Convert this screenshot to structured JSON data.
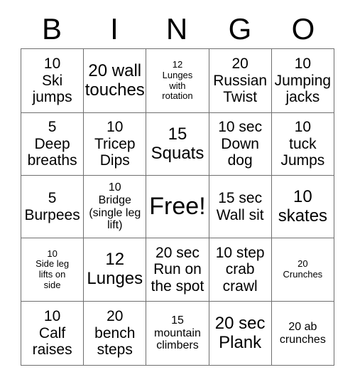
{
  "card": {
    "header": {
      "letters": [
        "B",
        "I",
        "N",
        "G",
        "O"
      ]
    },
    "rows": [
      [
        {
          "text": "10\nSki\njumps",
          "size": "fs-m"
        },
        {
          "text": "20 wall\ntouches",
          "size": "fs-l"
        },
        {
          "text": "12\nLunges\nwith\nrotation",
          "size": "fs-xs"
        },
        {
          "text": "20\nRussian\nTwist",
          "size": "fs-m"
        },
        {
          "text": "10\nJumping\njacks",
          "size": "fs-m"
        }
      ],
      [
        {
          "text": "5\nDeep\nbreaths",
          "size": "fs-m"
        },
        {
          "text": "10\nTricep\nDips",
          "size": "fs-m"
        },
        {
          "text": "15\nSquats",
          "size": "fs-l"
        },
        {
          "text": "10 sec\nDown\ndog",
          "size": "fs-m"
        },
        {
          "text": "10\ntuck\nJumps",
          "size": "fs-m"
        }
      ],
      [
        {
          "text": "5\nBurpees",
          "size": "fs-m"
        },
        {
          "text": "10\nBridge\n(single leg\nlift)",
          "size": "fs-s"
        },
        {
          "text": "Free!",
          "size": "fs-free"
        },
        {
          "text": "15 sec\nWall sit",
          "size": "fs-m"
        },
        {
          "text": "10\nskates",
          "size": "fs-l"
        }
      ],
      [
        {
          "text": "10\nSide leg\nlifts on\nside",
          "size": "fs-xs"
        },
        {
          "text": "12\nLunges",
          "size": "fs-l"
        },
        {
          "text": "20 sec\nRun on\nthe spot",
          "size": "fs-m"
        },
        {
          "text": "10 step\ncrab\ncrawl",
          "size": "fs-m"
        },
        {
          "text": "20\nCrunches",
          "size": "fs-xs"
        }
      ],
      [
        {
          "text": "10\nCalf\nraises",
          "size": "fs-m"
        },
        {
          "text": "20\nbench\nsteps",
          "size": "fs-m"
        },
        {
          "text": "15\nmountain\nclimbers",
          "size": "fs-s"
        },
        {
          "text": "20 sec\nPlank",
          "size": "fs-l"
        },
        {
          "text": "20 ab\ncrunches",
          "size": "fs-s"
        }
      ]
    ],
    "colors": {
      "border": "#6f6f6f",
      "text": "#000000",
      "background": "#ffffff"
    }
  }
}
